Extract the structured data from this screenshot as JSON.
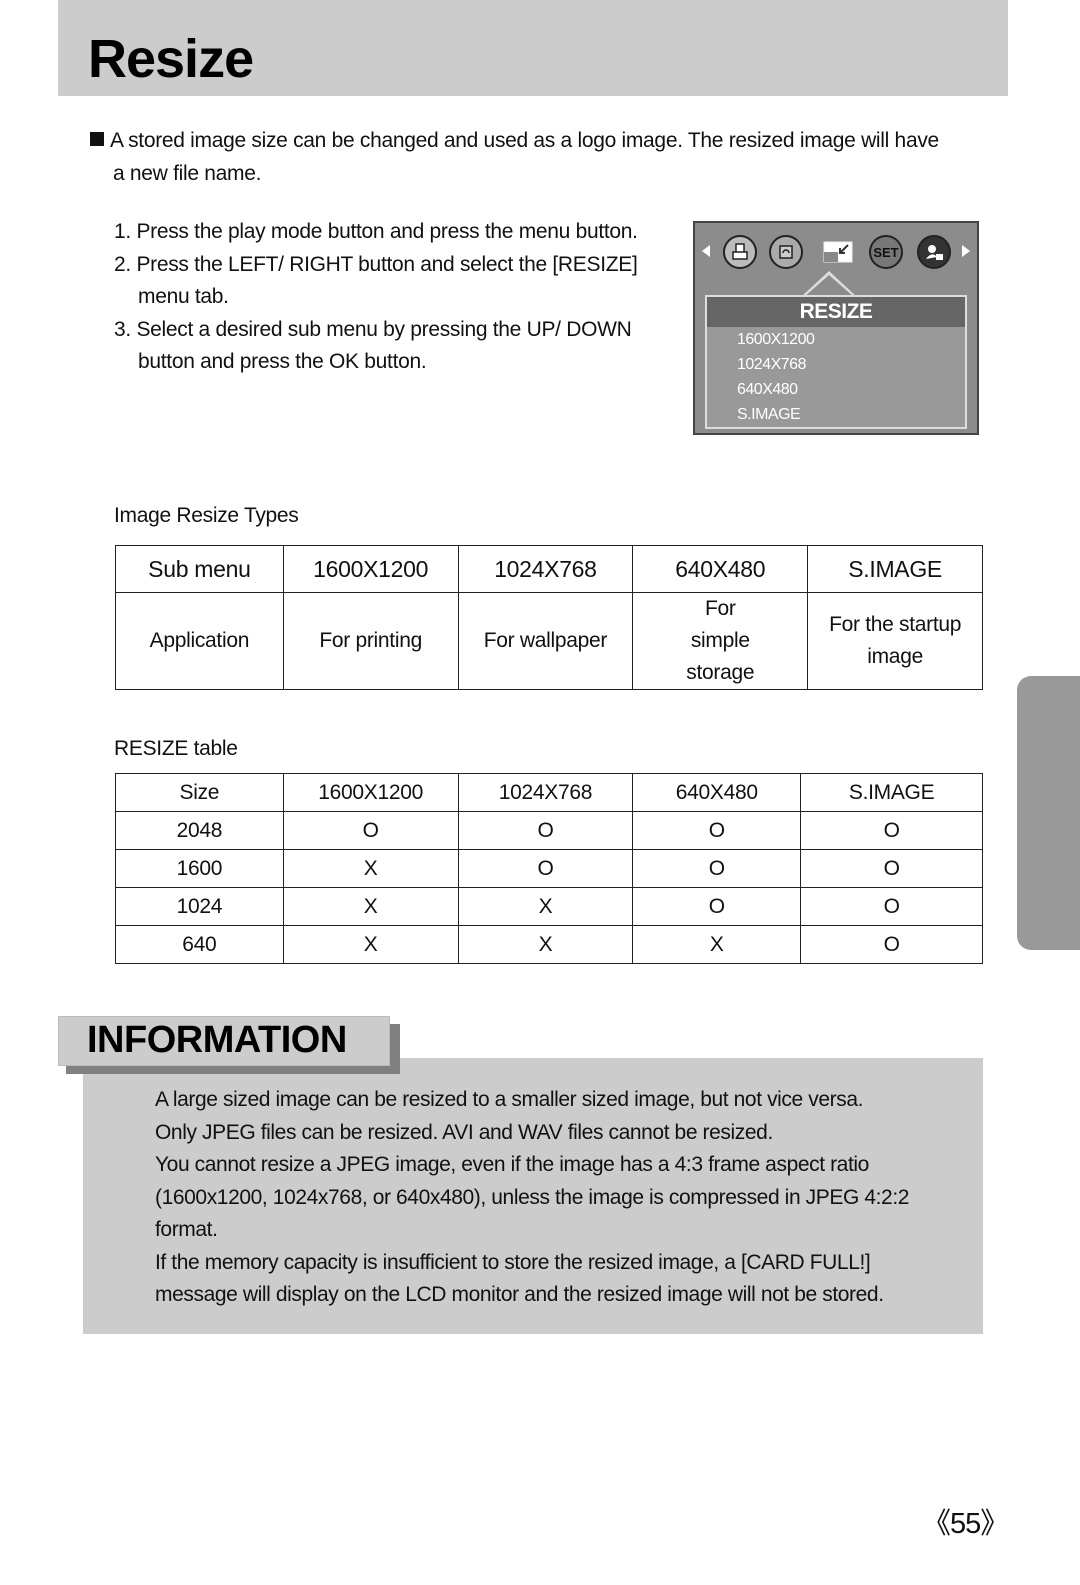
{
  "page": {
    "title": "Resize",
    "intro": "A stored image size can be changed and used as a logo image. The resized image will have",
    "intro_cont": "a new file name.",
    "steps": [
      "1. Press the play mode button and press the menu button.",
      "2. Press the LEFT/ RIGHT button and select the [RESIZE] menu tab.",
      "3. Select a desired sub menu by pressing the UP/ DOWN button and press the OK button."
    ],
    "page_number": "《55》"
  },
  "lcd": {
    "icons": [
      "print-icon",
      "rotate-icon",
      "resize-icon",
      "setup-icon",
      "start-image-icon"
    ],
    "set_label": "SET",
    "menu_title": "RESIZE",
    "menu_items": [
      "1600X1200",
      "1024X768",
      "640X480",
      "S.IMAGE"
    ]
  },
  "types_table": {
    "label": "Image Resize Types",
    "header": [
      "Sub menu",
      "1600X1200",
      "1024X768",
      "640X480",
      "S.IMAGE"
    ],
    "row": [
      "Application",
      "For printing",
      "For wallpaper",
      "For simple storage",
      "For the startup image"
    ]
  },
  "resize_table": {
    "label": "RESIZE table",
    "header": [
      "Size",
      "1600X1200",
      "1024X768",
      "640X480",
      "S.IMAGE"
    ],
    "rows": [
      [
        "2048",
        "O",
        "O",
        "O",
        "O"
      ],
      [
        "1600",
        "X",
        "O",
        "O",
        "O"
      ],
      [
        "1024",
        "X",
        "X",
        "O",
        "O"
      ],
      [
        "640",
        "X",
        "X",
        "X",
        "O"
      ]
    ]
  },
  "information": {
    "title": "INFORMATION",
    "paragraphs": [
      "A large sized image can be resized to a smaller sized image, but not vice versa.",
      "Only JPEG files can be resized. AVI and WAV files cannot be resized.",
      "You cannot resize a JPEG image, even if the image has a 4:3 frame aspect ratio (1600x1200, 1024x768, or 640x480), unless the image is compressed in JPEG 4:2:2 format.",
      "If the memory capacity is insufficient to store the resized image, a [CARD FULL!] message will display on the LCD monitor and the resized image will not be stored."
    ]
  }
}
